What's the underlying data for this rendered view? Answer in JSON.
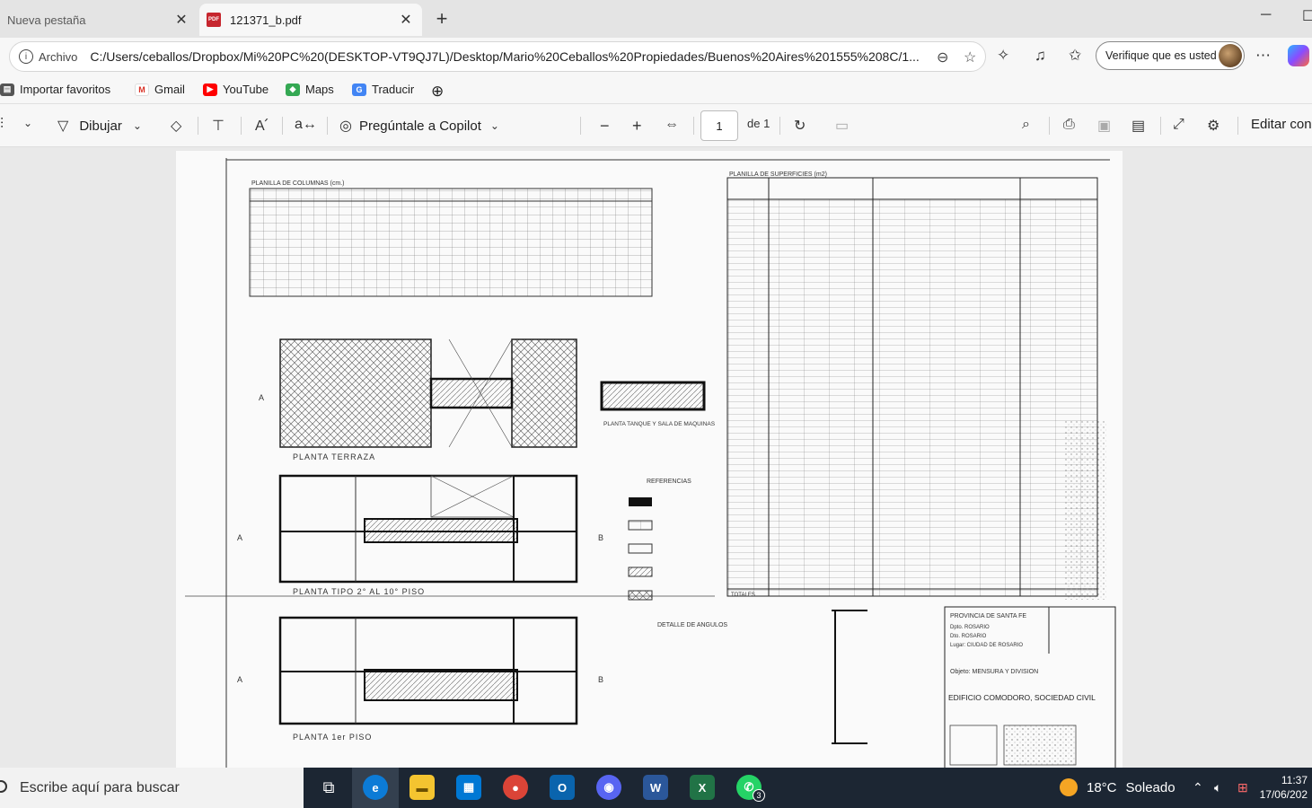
{
  "tabs": [
    {
      "title": "Nueva pestaña",
      "active": false
    },
    {
      "title": "121371_b.pdf",
      "active": true
    }
  ],
  "addressbar": {
    "scheme_label": "Archivo",
    "url": "C:/Users/ceballos/Dropbox/Mi%20PC%20(DESKTOP-VT9QJ7L)/Desktop/Mario%20Ceballos%20Propiedades/Buenos%20Aires%201555%208C/1...",
    "verify_label": "Verifique que es usted"
  },
  "favorites": [
    {
      "label": "Importar favoritos",
      "icon": "import-icon"
    },
    {
      "label": "Gmail",
      "icon": "gmail-icon"
    },
    {
      "label": "YouTube",
      "icon": "youtube-icon"
    },
    {
      "label": "Maps",
      "icon": "maps-icon"
    },
    {
      "label": "Traducir",
      "icon": "translate-icon"
    }
  ],
  "pdf_toolbar": {
    "draw_label": "Dibujar",
    "copilot_label": "Pregúntale a Copilot",
    "page_current": "1",
    "page_total": "de 1",
    "edit_label": "Editar con"
  },
  "document": {
    "columns_table_title": "PLANILLA DE COLUMNAS (cm.)",
    "surfaces_table_title": "PLANILLA DE SUPERFICIES (m2)",
    "plan_terrace": "PLANTA TERRAZA",
    "plan_tank": "PLANTA TANQUE Y SALA DE MAQUINAS",
    "plan_typical": "PLANTA TIPO 2° AL 10° PISO",
    "plan_first": "PLANTA 1er PISO",
    "references_title": "REFERENCIAS",
    "angles_title": "DETALLE DE ANGULOS",
    "province": "PROVINCIA DE SANTA FE",
    "dept": "Dpto. ROSARIO",
    "district": "Dto. ROSARIO",
    "place": "Lugar: CIUDAD DE ROSARIO",
    "object": "Objeto: MENSURA Y DIVISION",
    "owner": "EDIFICIO COMODORO, SOCIEDAD CIVIL",
    "totals_label": "TOTALES",
    "section_mark_a": "A",
    "section_mark_b": "B"
  },
  "taskbar": {
    "search_placeholder": "Escribe aquí para buscar",
    "weather_temp": "18°C",
    "weather_desc": "Soleado",
    "time": "11:37",
    "date": "17/06/202",
    "whatsapp_badge": "3"
  },
  "colors": {
    "taskbar_bg": "#1c2633",
    "edge_blue": "#0c7bd6",
    "accent": "#0078d4"
  }
}
